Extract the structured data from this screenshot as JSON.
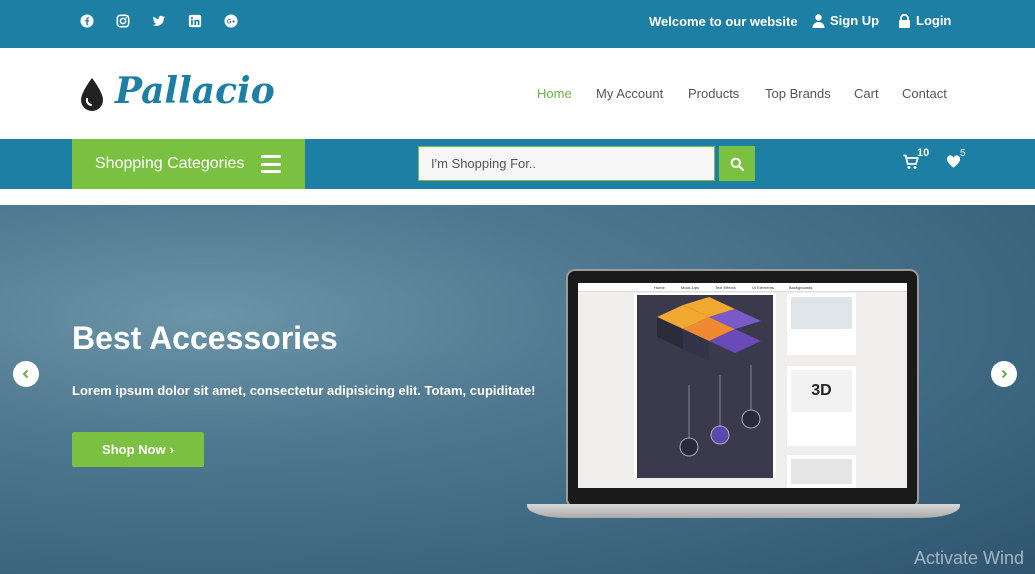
{
  "topbar": {
    "social_icons": [
      "facebook-icon",
      "instagram-icon",
      "twitter-icon",
      "linkedin-icon",
      "google-plus-icon"
    ],
    "welcome": "Welcome to our website",
    "signup_label": "Sign Up",
    "login_label": "Login"
  },
  "header": {
    "logo_text": "Pallacio",
    "nav": [
      {
        "label": "Home",
        "active": true
      },
      {
        "label": "My Account"
      },
      {
        "label": "Products"
      },
      {
        "label": "Top Brands"
      },
      {
        "label": "Cart"
      },
      {
        "label": "Contact"
      }
    ]
  },
  "searchbar": {
    "categories_label": "Shopping Categories",
    "placeholder": "I'm Shopping For..",
    "cart_count": "10",
    "wishlist_count": "5"
  },
  "hero": {
    "title": "Best Accessories",
    "subtitle": "Lorem ipsum dolor sit amet, consectetur adipisicing elit. Totam, cupiditate!",
    "button_label": "Shop Now",
    "screen_nav": [
      "Home",
      "Mock-Ups",
      "Text Effects",
      "UI Elements",
      "Backgrounds"
    ]
  },
  "watermark": "Activate Wind",
  "colors": {
    "primary": "#1c7fa3",
    "accent": "#7ac142"
  }
}
